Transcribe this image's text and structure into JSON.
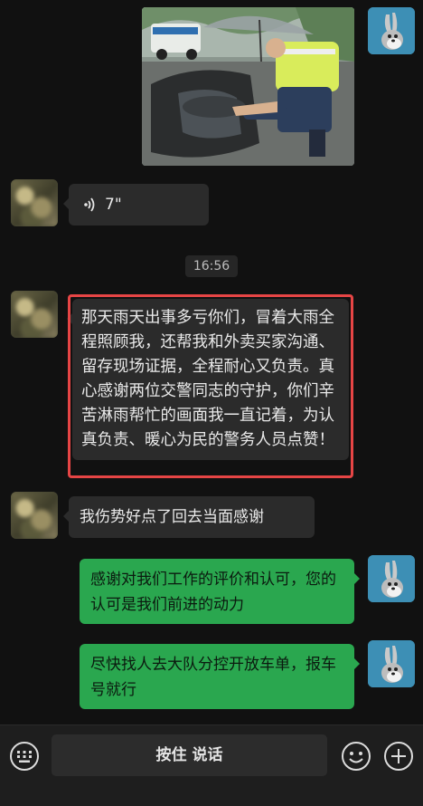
{
  "messages": {
    "voice": {
      "duration": "7\""
    },
    "time_divider": "16:56",
    "long_text": "那天雨天出事多亏你们，冒着大雨全程照顾我，还帮我和外卖买家沟通、留存现场证据，全程耐心又负责。真心感谢两位交警同志的守护，你们辛苦淋雨帮忙的画面我一直记着，为认真负责、暖心为民的警务人员点赞！",
    "injury_text": "我伤势好点了回去当面感谢",
    "reply_1": "感谢对我们工作的评价和认可，您的认可是我们前进的动力",
    "reply_2": "尽快找人去大队分控开放车单，报车号就行"
  },
  "input_bar": {
    "press_to_talk": "按住 说话",
    "keyboard_icon": "keyboard-icon",
    "emoji_icon": "emoji-icon",
    "plus_icon": "plus-icon"
  },
  "colors": {
    "background": "#111111",
    "my_bubble": "#2aa74f",
    "their_bubble": "#2b2b2b",
    "highlight_border": "#e64545"
  }
}
